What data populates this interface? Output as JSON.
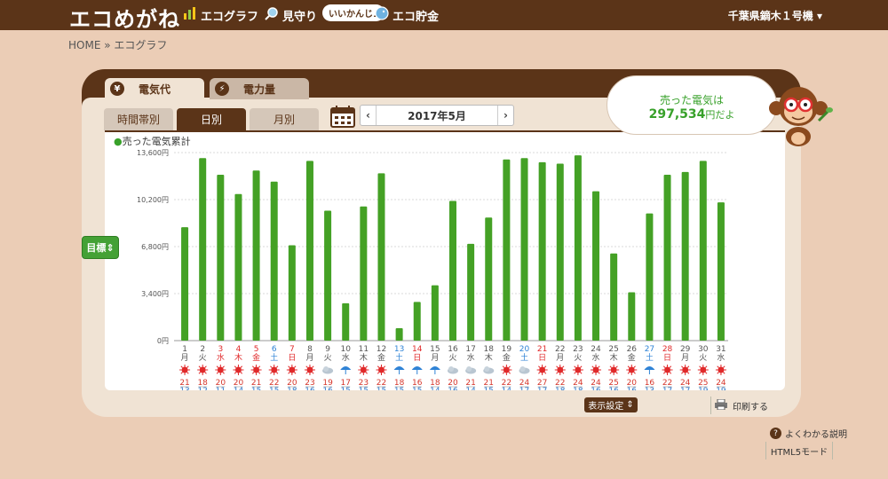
{
  "header": {
    "logo": "エコめがね",
    "nav": [
      {
        "label": "エコグラフ",
        "icon": "bar-chart-icon"
      },
      {
        "label": "見守り",
        "icon": "magnifier-icon"
      },
      {
        "label": "エコ貯金",
        "icon": "piggy-icon"
      }
    ],
    "bubble": "いいかんじ♪",
    "account": "千葉県鏑木１号機"
  },
  "breadcrumb": "HOME » エコグラフ",
  "tabs_main": [
    {
      "label": "電気代",
      "icon": "¥"
    },
    {
      "label": "電力量",
      "icon": "⚡"
    }
  ],
  "tabs_period": [
    "時間帯別",
    "日別",
    "月別"
  ],
  "date_label": "2017年5月",
  "legend": "売った電気累計",
  "goal_button": "目標",
  "sold": {
    "title": "売った電気は",
    "value": "297,534",
    "unit": "円だよ"
  },
  "buttons": {
    "settings": "表示設定",
    "print": "印刷する"
  },
  "help": "よくわかる説明",
  "html5": "HTML5モード",
  "colors": {
    "bar": "#44a125",
    "header": "#5b3418",
    "sun": "#e0292a",
    "rain": "#2f83d6",
    "high": "#d6352a",
    "low": "#2f77c8"
  },
  "chart_data": {
    "type": "bar",
    "ylim": [
      0,
      13600
    ],
    "yticks": [
      "0円",
      "3,400円",
      "6,800円",
      "10,200円",
      "13,600円"
    ],
    "categories": [
      "1",
      "2",
      "3",
      "4",
      "5",
      "6",
      "7",
      "8",
      "9",
      "10",
      "11",
      "12",
      "13",
      "14",
      "15",
      "16",
      "17",
      "18",
      "19",
      "20",
      "21",
      "22",
      "23",
      "24",
      "25",
      "26",
      "27",
      "28",
      "29",
      "30",
      "31"
    ],
    "weekdays": [
      "月",
      "火",
      "水",
      "木",
      "金",
      "土",
      "日",
      "月",
      "火",
      "水",
      "木",
      "金",
      "土",
      "日",
      "月",
      "火",
      "水",
      "木",
      "金",
      "土",
      "日",
      "月",
      "火",
      "水",
      "木",
      "金",
      "土",
      "日",
      "月",
      "火",
      "水"
    ],
    "holiday_or_weekend": [
      "n",
      "n",
      "h",
      "h",
      "h",
      "s",
      "h",
      "n",
      "n",
      "n",
      "n",
      "n",
      "s",
      "h",
      "n",
      "n",
      "n",
      "n",
      "n",
      "s",
      "h",
      "n",
      "n",
      "n",
      "n",
      "n",
      "s",
      "h",
      "n",
      "n",
      "n"
    ],
    "weather": [
      "sun",
      "sun",
      "sun",
      "sun",
      "sun",
      "sun",
      "sun",
      "sun",
      "cloud",
      "rain",
      "sun",
      "sun",
      "rain",
      "rain",
      "rain",
      "cloud",
      "cloud",
      "cloud",
      "sun",
      "cloud",
      "sun",
      "sun",
      "sun",
      "sun",
      "sun",
      "sun",
      "rain",
      "sun",
      "sun",
      "sun",
      "sun"
    ],
    "high": [
      "21",
      "18",
      "20",
      "20",
      "21",
      "22",
      "20",
      "23",
      "19",
      "17",
      "23",
      "22",
      "18",
      "16",
      "18",
      "20",
      "21",
      "21",
      "22",
      "24",
      "27",
      "22",
      "24",
      "24",
      "25",
      "20",
      "16",
      "22",
      "24",
      "25",
      "24"
    ],
    "low": [
      "13",
      "12",
      "11",
      "14",
      "15",
      "15",
      "18",
      "16",
      "16",
      "15",
      "15",
      "15",
      "15",
      "15",
      "14",
      "16",
      "14",
      "15",
      "14",
      "17",
      "17",
      "18",
      "18",
      "16",
      "16",
      "16",
      "13",
      "17",
      "17",
      "19",
      "19"
    ],
    "values": [
      8200,
      13200,
      12000,
      10600,
      12300,
      11500,
      6900,
      13000,
      9400,
      2700,
      9700,
      12100,
      900,
      2800,
      4000,
      10100,
      7000,
      8900,
      13100,
      13200,
      12900,
      12800,
      13400,
      10800,
      6300,
      3500,
      9200,
      12000,
      12200,
      13000,
      10000
    ]
  }
}
